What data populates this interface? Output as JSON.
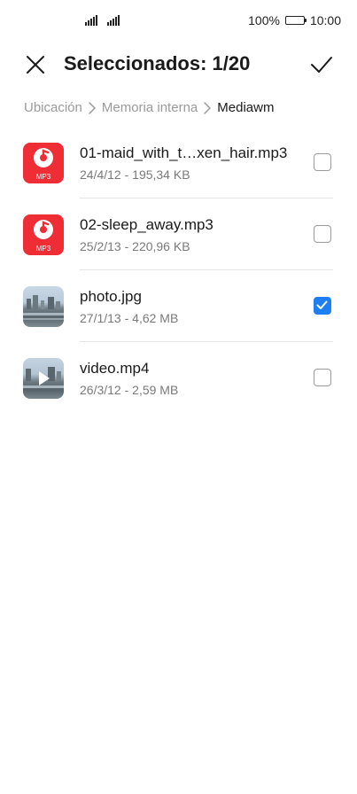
{
  "status_bar": {
    "battery_percent": "100%",
    "time": "10:00"
  },
  "header": {
    "title": "Seleccionados: 1/20",
    "close_icon": "close-icon",
    "confirm_icon": "check-icon"
  },
  "breadcrumb": {
    "items": [
      "Ubicación",
      "Memoria interna",
      "Mediawm"
    ]
  },
  "files": [
    {
      "name": "01-maid_with_t…xen_hair.mp3",
      "meta": "24/4/12 - 195,34 KB",
      "type_label": "MP3",
      "checked": false
    },
    {
      "name": "02-sleep_away.mp3",
      "meta": "25/2/13 - 220,96 KB",
      "type_label": "MP3",
      "checked": false
    },
    {
      "name": "photo.jpg",
      "meta": "27/1/13 - 4,62 MB",
      "checked": true
    },
    {
      "name": "video.mp4",
      "meta": "26/3/12 - 2,59 MB",
      "checked": false
    }
  ],
  "colors": {
    "accent": "#1d7ff2",
    "mp3_icon": "#ee2d35"
  }
}
